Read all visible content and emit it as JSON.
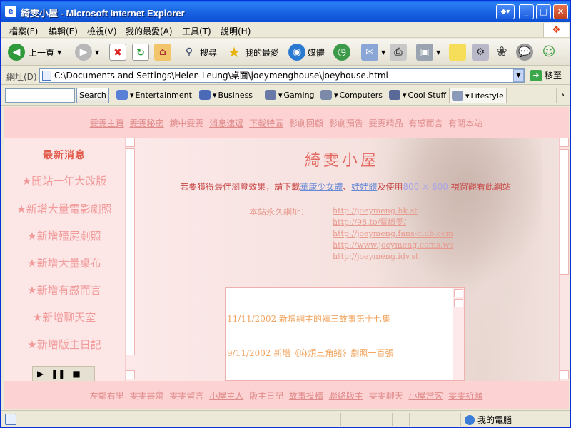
{
  "window": {
    "title": "綺雯小屋 - Microsoft Internet Explorer",
    "go_label": "◆▾",
    "min": "_",
    "max": "□",
    "close": "✕"
  },
  "menu": [
    "檔案(F)",
    "編輯(E)",
    "檢視(V)",
    "我的最愛(A)",
    "工具(T)",
    "說明(H)"
  ],
  "toolbar": {
    "back": "上一頁",
    "search": "搜尋",
    "favorites": "我的最愛",
    "media": "媒體"
  },
  "address": {
    "label": "網址(D)",
    "value": "C:\\Documents and Settings\\Helen Leung\\桌面\\joeymenghouse\\joeyhouse.html",
    "go": "移至"
  },
  "links": {
    "search_button": "Search",
    "items": [
      "Entertainment",
      "Business",
      "Gaming",
      "Computers",
      "Cool Stuff",
      "Lifestyle"
    ]
  },
  "site": {
    "top_nav": [
      "雯雯主頁",
      "雯雯秘密",
      "鏡中雯雯",
      "消息速遞",
      "下載特區",
      "影劇回顧",
      "影劇預告",
      "雯雯精品",
      "有感而言",
      "有關本站"
    ],
    "news_title": "最新消息",
    "news_items": [
      "★開站一年大改版",
      "★新增大量電影劇照",
      "★新增殭屍劇照",
      "★新增大量桌布",
      "★新增有感而言",
      "★新增聊天室",
      "★新增版主日記"
    ],
    "title": "綺雯小屋",
    "tip_pre": "若要獲得最佳瀏覽效果，請下載",
    "tip_font1": "華康少女體",
    "tip_sep": "、",
    "tip_font2": "娃娃體",
    "tip_mid": "及使用",
    "tip_res": "800 × 600",
    "tip_post": " 視窗觀看此網站",
    "url_label": "本站永久網址：",
    "urls": [
      "http://joeymeng.hk.st",
      "http://98.to/蔡綺雯/",
      "http://joeymeng.fans-club.com",
      "http://www.joeymeng.coms.ws",
      "http://joeymeng.idv.st"
    ],
    "updates": [
      "11/11/2002  新增網主的殭三故事第十七集",
      "9/11/2002   新增《麻煩三角緒》劇照一百張"
    ],
    "bottom_nav": [
      "左鄰右里",
      "雯雯書齋",
      "雯雯留言",
      "小屋主人",
      "版主日記",
      "故事投稿",
      "聯絡版主",
      "雯雯聊天",
      "小屋常客",
      "雯雯祈願"
    ]
  },
  "status": {
    "zone": "我的電腦"
  }
}
